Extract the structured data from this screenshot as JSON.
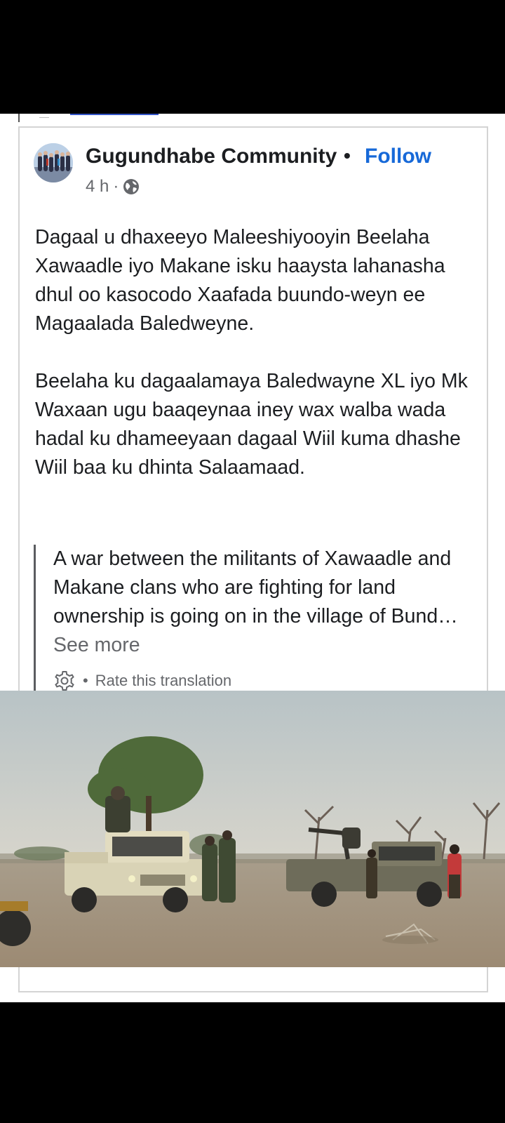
{
  "post": {
    "page_name": "Gugundhabe Community",
    "separator": "•",
    "follow_label": "Follow",
    "time": "4 h",
    "time_separator": "·",
    "privacy_icon": "globe-icon",
    "body_paragraph_1": "Dagaal u dhaxeeyo Maleeshiyooyin Beelaha Xawaadle iyo Makane isku haaysta lahanasha dhul oo kasocodo Xaafada buundo-weyn ee Magaalada Baledweyne.",
    "body_paragraph_2": "Beelaha ku dagaalamaya Baledwayne XL iyo Mk Waxaan ugu baaqeynaa iney wax walba wada hadal ku dhameeyaan dagaal Wiil kuma dhashe Wiil baa ku dhinta Salaamaad.",
    "translation_text": "A war between the militants of Xawaadle and Makane clans who are fighting for land ownership is going on in the village of Bund…",
    "see_more_label": "See more",
    "rate_separator": "•",
    "rate_translation_label": "Rate this translation"
  },
  "colors": {
    "link_blue": "#1769d8",
    "text_primary": "#1c1e21",
    "text_secondary": "#65676b",
    "border": "#d4d4d4"
  }
}
